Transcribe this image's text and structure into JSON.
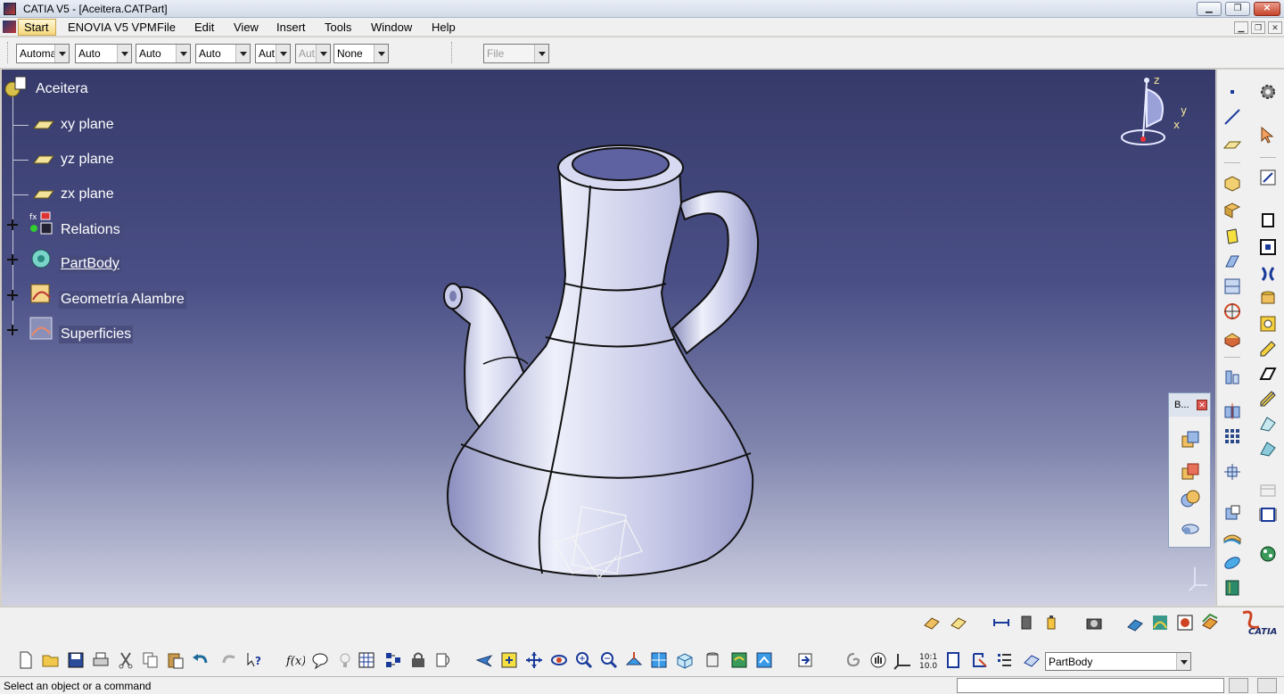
{
  "window": {
    "title": "CATIA V5 - [Aceitera.CATPart]",
    "buttons": {
      "minimize": "▁",
      "restore": "❐",
      "close": "✕"
    }
  },
  "menu": {
    "items": [
      "Start",
      "ENOVIA V5 VPM",
      "File",
      "Edit",
      "View",
      "Insert",
      "Tools",
      "Window",
      "Help"
    ]
  },
  "toolbar": {
    "combos": [
      "Automa",
      "Auto",
      "Auto",
      "Auto",
      "Aut",
      "Aut",
      "None",
      "File"
    ]
  },
  "tree": {
    "root": "Aceitera",
    "nodes": [
      "xy plane",
      "yz plane",
      "zx plane",
      "Relations",
      "PartBody",
      "Geometría Alambre",
      "Superficies"
    ]
  },
  "compass": {
    "x": "x",
    "y": "y",
    "z": "z"
  },
  "floating_toolbar": {
    "title": "B...",
    "close": "✕"
  },
  "bottom": {
    "current_body": "PartBody"
  },
  "status": {
    "message": "Select an object or a command"
  },
  "colors": {
    "viewport_top": "#363a6a",
    "viewport_bottom": "#cfd1e2",
    "part": "#b9bbe0"
  }
}
